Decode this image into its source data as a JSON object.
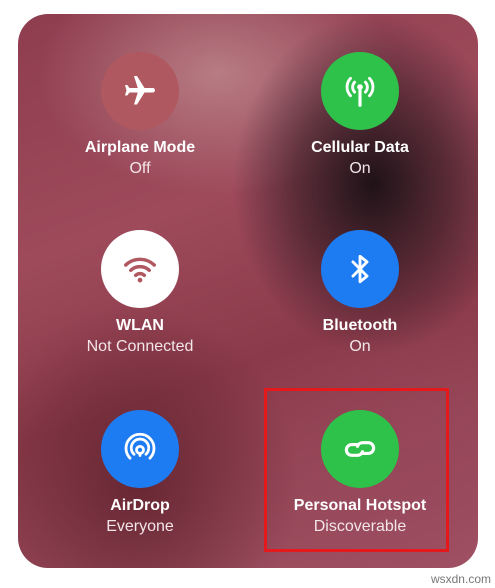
{
  "tiles": [
    {
      "title": "Airplane Mode",
      "status": "Off",
      "icon": "airplane-icon",
      "state": "off",
      "color": "#b0585f"
    },
    {
      "title": "Cellular Data",
      "status": "On",
      "icon": "antenna-icon",
      "state": "on",
      "color": "#2ec24a"
    },
    {
      "title": "WLAN",
      "status": "Not Connected",
      "icon": "wifi-icon",
      "state": "white",
      "color": "#ffffff"
    },
    {
      "title": "Bluetooth",
      "status": "On",
      "icon": "bluetooth-icon",
      "state": "on",
      "color": "#1e7cf2"
    },
    {
      "title": "AirDrop",
      "status": "Everyone",
      "icon": "airdrop-icon",
      "state": "on",
      "color": "#1e7cf2"
    },
    {
      "title": "Personal Hotspot",
      "status": "Discoverable",
      "icon": "hotspot-link-icon",
      "state": "on",
      "color": "#2ec24a"
    }
  ],
  "highlight_color": "#e5191c",
  "watermark": "wsxdn.com"
}
